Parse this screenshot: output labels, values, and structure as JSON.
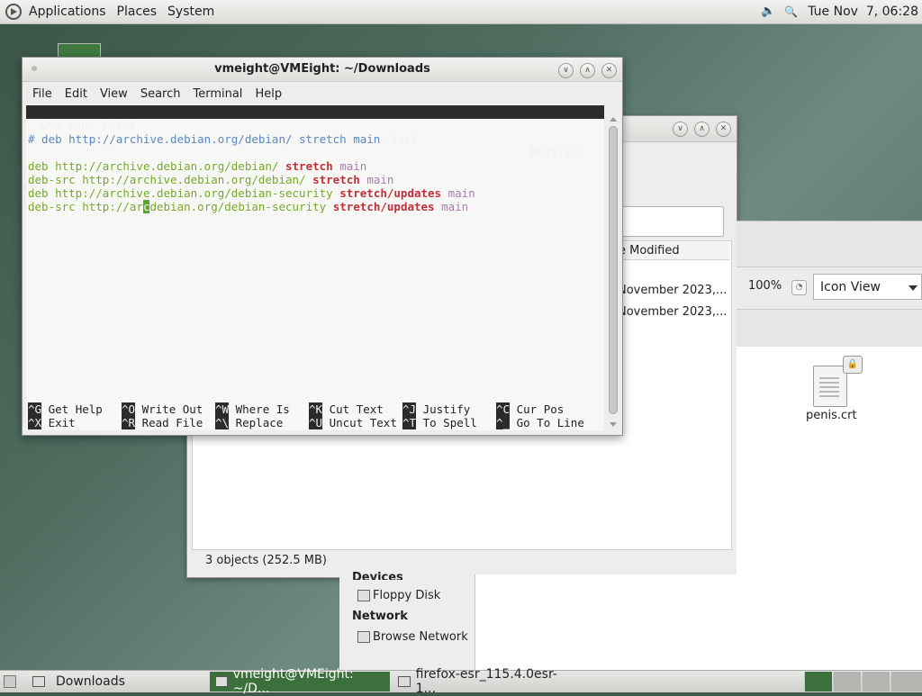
{
  "top_panel": {
    "menus": [
      "Applications",
      "Places",
      "System"
    ],
    "clock": "Tue Nov  7, 06:28"
  },
  "terminal": {
    "title": "vmeight@VMEight: ~/Downloads",
    "menu": [
      "File",
      "Edit",
      "View",
      "Search",
      "Terminal",
      "Help"
    ],
    "nano": {
      "version": "GNU nano 2.7.4",
      "file": "File: /etc/apt/sources.list",
      "state": "Modified",
      "comment_line": "# deb http://archive.debian.org/debian/ stretch main",
      "lines": [
        {
          "type": "deb",
          "url": "http://archive.debian.org/debian/",
          "release": "stretch",
          "component": "main"
        },
        {
          "type": "deb-src",
          "url": "http://archive.debian.org/debian/",
          "release": "stretch",
          "component": "main"
        },
        {
          "type": "deb",
          "url": "http://archive.debian.org/debian-security",
          "release": "stretch/updates",
          "component": "main"
        },
        {
          "type": "deb-src",
          "url_before": "http://ar",
          "url_cursor": "c",
          "url_after": "debian.org/debian-security",
          "release": "stretch/updates",
          "component": "main"
        }
      ],
      "shortcuts_row1": [
        {
          "key": "^G",
          "label": "Get Help"
        },
        {
          "key": "^O",
          "label": "Write Out"
        },
        {
          "key": "^W",
          "label": "Where Is"
        },
        {
          "key": "^K",
          "label": "Cut Text"
        },
        {
          "key": "^J",
          "label": "Justify"
        },
        {
          "key": "^C",
          "label": "Cur Pos"
        }
      ],
      "shortcuts_row2": [
        {
          "key": "^X",
          "label": "Exit"
        },
        {
          "key": "^R",
          "label": "Read File"
        },
        {
          "key": "^\\",
          "label": "Replace"
        },
        {
          "key": "^U",
          "label": "Uncut Text"
        },
        {
          "key": "^T",
          "label": "To Spell"
        },
        {
          "key": "^_",
          "label": "Go To Line"
        }
      ]
    }
  },
  "file_manager": {
    "column_header": "e Modified",
    "rows": [
      "November 2023,...",
      "November 2023,..."
    ],
    "status": "3 objects (252.5 MB)"
  },
  "file_manager_right": {
    "zoom": "100%",
    "view_mode": "Icon View",
    "file_name": "penis.crt"
  },
  "sidebar": {
    "devices_heading": "Devices",
    "floppy": "Floppy Disk",
    "network_heading": "Network",
    "browse_network": "Browse Network"
  },
  "taskbar": {
    "items": [
      "Downloads",
      "vmeight@VMEight: ~/D...",
      "firefox-esr_115.4.0esr-1..."
    ]
  }
}
